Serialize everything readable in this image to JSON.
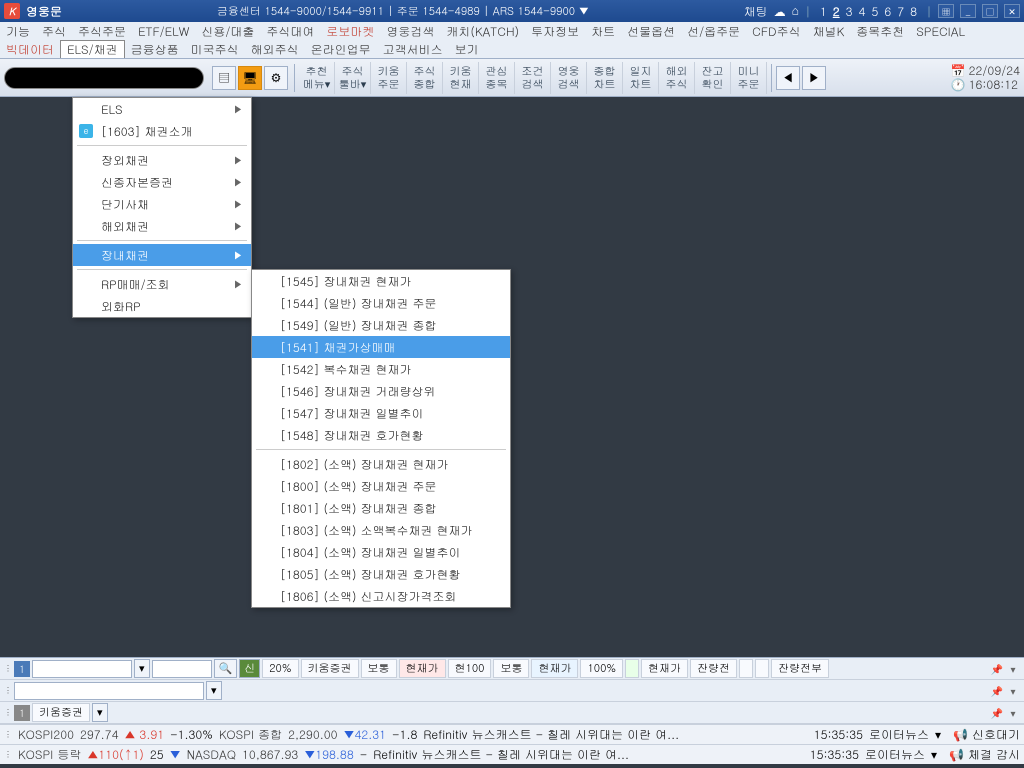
{
  "titlebar": {
    "title": "영웅문",
    "center": "금융센터 1544-9000/1544-9911 | 주문 1544-4989 | ARS 1544-9900 ▼",
    "chat": "채팅",
    "nums": [
      "1",
      "2",
      "3",
      "4",
      "5",
      "6",
      "7",
      "8"
    ]
  },
  "menu": {
    "row1": [
      "기능",
      "주식",
      "주식주문",
      "ETF/ELW",
      "신용/대출",
      "주식대여",
      "로보마켓",
      "영웅검색",
      "캐치(KATCH)",
      "투자정보",
      "차트",
      "선물옵션",
      "선/옵주문",
      "CFD주식",
      "채널K",
      "종목추천",
      "SPECIAL"
    ],
    "row2": [
      "빅데이터",
      "ELS/채권",
      "금융상품",
      "미국주식",
      "해외주식",
      "온라인업무",
      "고객서비스",
      "보기"
    ]
  },
  "toolbar": {
    "btns": [
      [
        "추천",
        "메뉴▾"
      ],
      [
        "주식",
        "툴바▾"
      ],
      [
        "키움",
        "주문"
      ],
      [
        "주식",
        "종합"
      ],
      [
        "키움",
        "현재"
      ],
      [
        "관심",
        "종목"
      ],
      [
        "조건",
        "검색"
      ],
      [
        "영웅",
        "검색"
      ],
      [
        "종합",
        "차트"
      ],
      [
        "일지",
        "차트"
      ],
      [
        "해외",
        "주식"
      ],
      [
        "잔고",
        "확인"
      ],
      [
        "미니",
        "주문"
      ]
    ],
    "date": "22/09/24",
    "time": "16:08:12"
  },
  "dropdown1": [
    {
      "label": "ELS",
      "arrow": true
    },
    {
      "label": "[1603] 채권소개",
      "icon": true
    },
    {
      "sep": true
    },
    {
      "label": "장외채권",
      "arrow": true
    },
    {
      "label": "신종자본증권",
      "arrow": true
    },
    {
      "label": "단기사채",
      "arrow": true
    },
    {
      "label": "해외채권",
      "arrow": true
    },
    {
      "sep": true
    },
    {
      "label": "장내채권",
      "arrow": true,
      "hl": true
    },
    {
      "sep": true
    },
    {
      "label": "RP매매/조회",
      "arrow": true
    },
    {
      "label": "외화RP"
    }
  ],
  "dropdown2": [
    {
      "label": "[1545] 장내채권 현재가"
    },
    {
      "label": "[1544] (일반) 장내채권 주문"
    },
    {
      "label": "[1549] (일반) 장내채권 종합"
    },
    {
      "label": "[1541] 채권가상매매",
      "hl": true
    },
    {
      "label": "[1542] 복수채권 현재가"
    },
    {
      "label": "[1546] 장내채권 거래량상위"
    },
    {
      "label": "[1547] 장내채권 일별추이"
    },
    {
      "label": "[1548] 장내채권 호가현황"
    },
    {
      "sep": true
    },
    {
      "label": "[1802] (소액) 장내채권 현재가"
    },
    {
      "label": "[1800] (소액) 장내채권 주문"
    },
    {
      "label": "[1801] (소액) 장내채권 종합"
    },
    {
      "label": "[1803] (소액) 소액복수채권 현재가"
    },
    {
      "label": "[1804] (소액) 장내채권 일별추이"
    },
    {
      "label": "[1805] (소액) 장내채권 호가현황"
    },
    {
      "label": "[1806] (소액) 신고시장가격조회"
    }
  ],
  "dock": {
    "sin": "신",
    "pct": "20%",
    "broker": "키움증권",
    "row1cells": [
      "보통",
      "현재가",
      "현100",
      "보통",
      "현재가",
      "100%",
      "",
      "현재가",
      "잔량전",
      "",
      "",
      "잔량전부"
    ],
    "broker2": "키움증권"
  },
  "tickers": [
    {
      "lbl": "KOSPI200",
      "v1": "297.74",
      "v2": "▲ 3.91",
      "v2c": "up",
      "v3": "-1.30%",
      "lbl2": "KOSPI 종합",
      "v4": "2,290.00",
      "v5": "▼42.31",
      "v5c": "down",
      "v6": "-1.8",
      "news": "Refinitiv 뉴스캐스트 - 칠레 시위대는 이란 여...",
      "time": "15:35:35",
      "src": "로이터뉴스",
      "ext": "신호대기"
    },
    {
      "lbl": "KOSPI 등락",
      "v1": "▲110(↑1)",
      "v1c": "up",
      "v2": "25",
      "v3": "▼",
      "v3c": "down",
      "lbl2": "NASDAQ",
      "v4": "10,867.93",
      "v5": "▼198.88",
      "v5c": "down",
      "v6": "-",
      "news": "Refinitiv 뉴스캐스트 - 칠레 시위대는 이란 여...",
      "time": "15:35:35",
      "src": "로이터뉴스",
      "ext": "체결  감시"
    }
  ]
}
